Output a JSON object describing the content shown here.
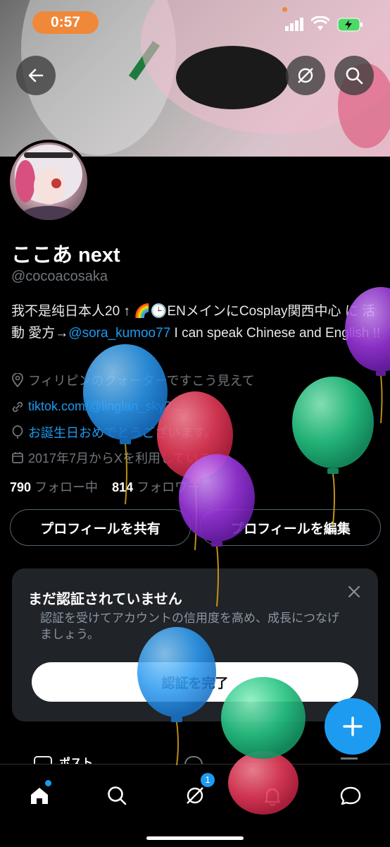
{
  "status_bar": {
    "time": "0:57"
  },
  "header": {
    "back_icon": "arrow-left-icon",
    "grok_icon": "grok-icon",
    "search_icon": "search-icon"
  },
  "profile": {
    "name": "ここあ next",
    "handle": "@cocoacosaka",
    "bio_part1": "我不是纯日本人20 ↑ 🌈🕒ENメインにCosplay関西中心 に 活動 愛方→",
    "bio_mention": "@sora_kumoo77",
    "bio_part2": " I can speak Chinese and English !!",
    "location": "フィリピンのクォーターですこう見えて",
    "link": "tiktok.com/@linglan_sky?...",
    "birthday": "お誕生日おめでとうございます。",
    "joined": "2017年7月からXを利用しています",
    "following_count": "790",
    "following_label": "フォロー中",
    "followers_count": "814",
    "followers_label": "フォロワー"
  },
  "actions": {
    "share_label": "プロフィールを共有",
    "edit_label": "プロフィールを編集"
  },
  "verify_card": {
    "title": "まだ認証されていません",
    "body": "認証を受けてアカウントの信用度を高め、成長につなげましょう。",
    "button_label": "認証を完了"
  },
  "tabs_peek": {
    "posts_label": "ポスト"
  },
  "bottom_nav": {
    "items": [
      "home-icon",
      "search-icon",
      "grok-icon",
      "notifications-icon",
      "messages-icon"
    ],
    "grok_badge": "1"
  },
  "colors": {
    "accent": "#1d9bf0",
    "background": "#000000",
    "card": "#202327",
    "muted": "#71767b"
  }
}
